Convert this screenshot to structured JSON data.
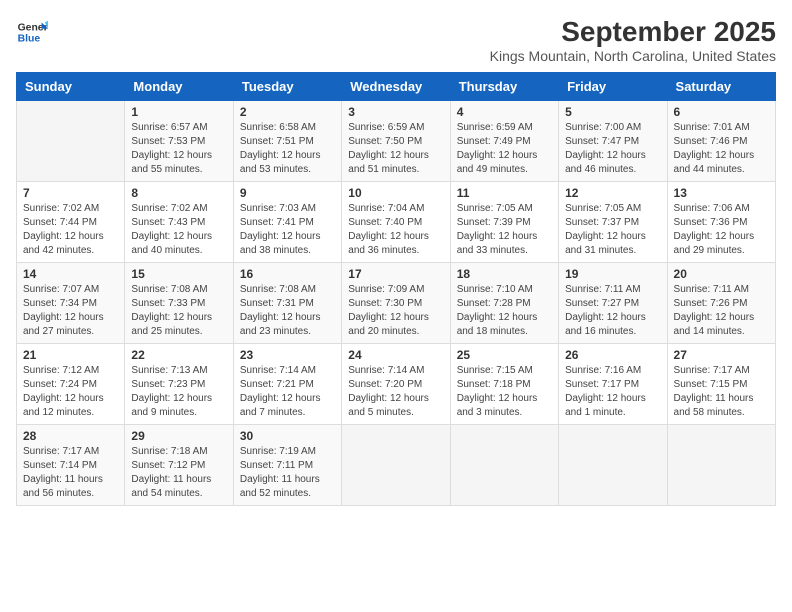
{
  "logo": {
    "line1": "General",
    "line2": "Blue"
  },
  "title": "September 2025",
  "subtitle": "Kings Mountain, North Carolina, United States",
  "header": {
    "days": [
      "Sunday",
      "Monday",
      "Tuesday",
      "Wednesday",
      "Thursday",
      "Friday",
      "Saturday"
    ]
  },
  "weeks": [
    [
      {
        "day": "",
        "empty": true
      },
      {
        "day": "1",
        "sunrise": "6:57 AM",
        "sunset": "7:53 PM",
        "daylight": "12 hours and 55 minutes."
      },
      {
        "day": "2",
        "sunrise": "6:58 AM",
        "sunset": "7:51 PM",
        "daylight": "12 hours and 53 minutes."
      },
      {
        "day": "3",
        "sunrise": "6:59 AM",
        "sunset": "7:50 PM",
        "daylight": "12 hours and 51 minutes."
      },
      {
        "day": "4",
        "sunrise": "6:59 AM",
        "sunset": "7:49 PM",
        "daylight": "12 hours and 49 minutes."
      },
      {
        "day": "5",
        "sunrise": "7:00 AM",
        "sunset": "7:47 PM",
        "daylight": "12 hours and 46 minutes."
      },
      {
        "day": "6",
        "sunrise": "7:01 AM",
        "sunset": "7:46 PM",
        "daylight": "12 hours and 44 minutes."
      }
    ],
    [
      {
        "day": "7",
        "sunrise": "7:02 AM",
        "sunset": "7:44 PM",
        "daylight": "12 hours and 42 minutes."
      },
      {
        "day": "8",
        "sunrise": "7:02 AM",
        "sunset": "7:43 PM",
        "daylight": "12 hours and 40 minutes."
      },
      {
        "day": "9",
        "sunrise": "7:03 AM",
        "sunset": "7:41 PM",
        "daylight": "12 hours and 38 minutes."
      },
      {
        "day": "10",
        "sunrise": "7:04 AM",
        "sunset": "7:40 PM",
        "daylight": "12 hours and 36 minutes."
      },
      {
        "day": "11",
        "sunrise": "7:05 AM",
        "sunset": "7:39 PM",
        "daylight": "12 hours and 33 minutes."
      },
      {
        "day": "12",
        "sunrise": "7:05 AM",
        "sunset": "7:37 PM",
        "daylight": "12 hours and 31 minutes."
      },
      {
        "day": "13",
        "sunrise": "7:06 AM",
        "sunset": "7:36 PM",
        "daylight": "12 hours and 29 minutes."
      }
    ],
    [
      {
        "day": "14",
        "sunrise": "7:07 AM",
        "sunset": "7:34 PM",
        "daylight": "12 hours and 27 minutes."
      },
      {
        "day": "15",
        "sunrise": "7:08 AM",
        "sunset": "7:33 PM",
        "daylight": "12 hours and 25 minutes."
      },
      {
        "day": "16",
        "sunrise": "7:08 AM",
        "sunset": "7:31 PM",
        "daylight": "12 hours and 23 minutes."
      },
      {
        "day": "17",
        "sunrise": "7:09 AM",
        "sunset": "7:30 PM",
        "daylight": "12 hours and 20 minutes."
      },
      {
        "day": "18",
        "sunrise": "7:10 AM",
        "sunset": "7:28 PM",
        "daylight": "12 hours and 18 minutes."
      },
      {
        "day": "19",
        "sunrise": "7:11 AM",
        "sunset": "7:27 PM",
        "daylight": "12 hours and 16 minutes."
      },
      {
        "day": "20",
        "sunrise": "7:11 AM",
        "sunset": "7:26 PM",
        "daylight": "12 hours and 14 minutes."
      }
    ],
    [
      {
        "day": "21",
        "sunrise": "7:12 AM",
        "sunset": "7:24 PM",
        "daylight": "12 hours and 12 minutes."
      },
      {
        "day": "22",
        "sunrise": "7:13 AM",
        "sunset": "7:23 PM",
        "daylight": "12 hours and 9 minutes."
      },
      {
        "day": "23",
        "sunrise": "7:14 AM",
        "sunset": "7:21 PM",
        "daylight": "12 hours and 7 minutes."
      },
      {
        "day": "24",
        "sunrise": "7:14 AM",
        "sunset": "7:20 PM",
        "daylight": "12 hours and 5 minutes."
      },
      {
        "day": "25",
        "sunrise": "7:15 AM",
        "sunset": "7:18 PM",
        "daylight": "12 hours and 3 minutes."
      },
      {
        "day": "26",
        "sunrise": "7:16 AM",
        "sunset": "7:17 PM",
        "daylight": "12 hours and 1 minute."
      },
      {
        "day": "27",
        "sunrise": "7:17 AM",
        "sunset": "7:15 PM",
        "daylight": "11 hours and 58 minutes."
      }
    ],
    [
      {
        "day": "28",
        "sunrise": "7:17 AM",
        "sunset": "7:14 PM",
        "daylight": "11 hours and 56 minutes."
      },
      {
        "day": "29",
        "sunrise": "7:18 AM",
        "sunset": "7:12 PM",
        "daylight": "11 hours and 54 minutes."
      },
      {
        "day": "30",
        "sunrise": "7:19 AM",
        "sunset": "7:11 PM",
        "daylight": "11 hours and 52 minutes."
      },
      {
        "day": "",
        "empty": true
      },
      {
        "day": "",
        "empty": true
      },
      {
        "day": "",
        "empty": true
      },
      {
        "day": "",
        "empty": true
      }
    ]
  ],
  "labels": {
    "sunrise": "Sunrise:",
    "sunset": "Sunset:",
    "daylight": "Daylight:"
  }
}
